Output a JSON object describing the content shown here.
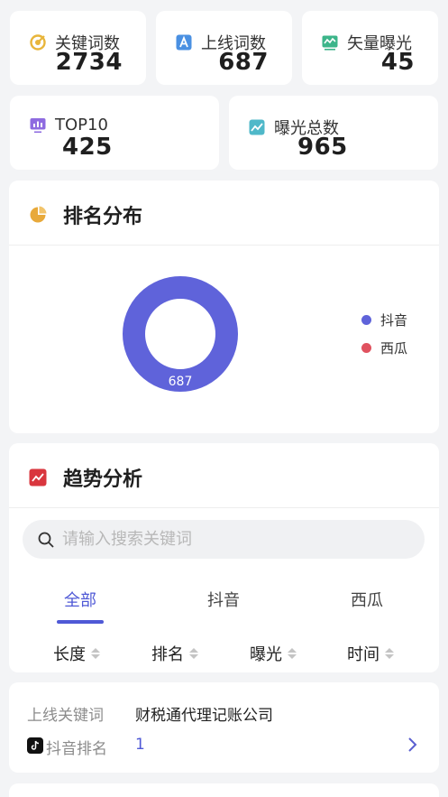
{
  "stats": [
    {
      "label": "关键词数",
      "value": "2734",
      "icon": "target-icon",
      "color": "#e8b53a"
    },
    {
      "label": "上线词数",
      "value": "687",
      "icon": "letter-a-icon",
      "color": "#4a90e2"
    },
    {
      "label": "矢量曝光",
      "value": "45",
      "icon": "wave-chart-icon",
      "color": "#3cb58a"
    },
    {
      "label": "TOP10",
      "value": "425",
      "icon": "bar-monitor-icon",
      "color": "#8e6be0"
    },
    {
      "label": "曝光总数",
      "value": "965",
      "icon": "trend-line-icon",
      "color": "#4fb8c9"
    }
  ],
  "ranking": {
    "title": "排名分布",
    "icon": "pie-chart-icon"
  },
  "chart_data": {
    "type": "pie",
    "categories": [
      "抖音",
      "西瓜"
    ],
    "values": [
      687,
      0
    ],
    "colors": [
      "#5f63da",
      "#e0525f"
    ],
    "data_labels": [
      "687"
    ],
    "legend_position": "right"
  },
  "trend": {
    "title": "趋势分析",
    "icon": "trend-chart-icon",
    "search_placeholder": "请输入搜索关键词",
    "tabs": [
      "全部",
      "抖音",
      "西瓜"
    ],
    "active_tab": "全部",
    "sort_columns": [
      "长度",
      "排名",
      "曝光",
      "时间"
    ]
  },
  "keyword_item": {
    "keyword_label": "上线关键词",
    "keyword_value": "财税通代理记账公司",
    "rank_label": "抖音排名",
    "rank_value": "1"
  }
}
